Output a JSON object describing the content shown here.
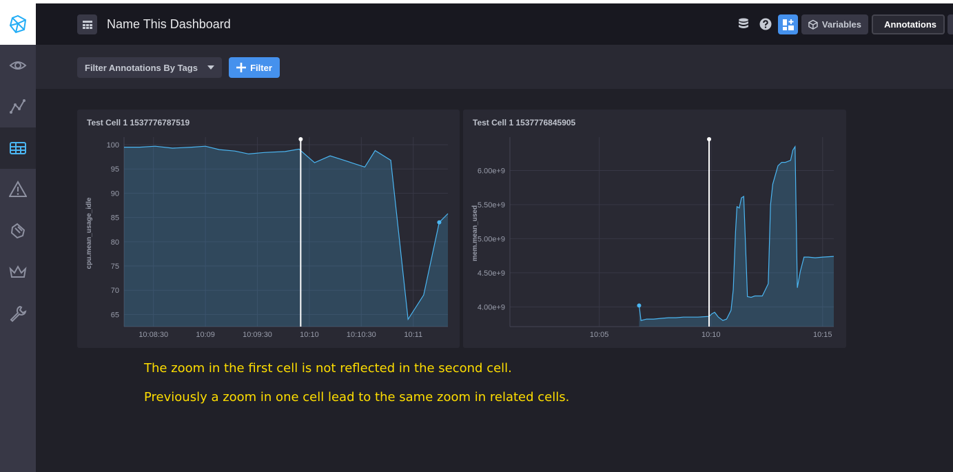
{
  "header": {
    "title": "Name This Dashboard",
    "buttons": {
      "variables": "Variables",
      "annotations": "Annotations"
    }
  },
  "sidebar": {
    "items": [
      {
        "icon": "eye-icon"
      },
      {
        "icon": "graph-icon"
      },
      {
        "icon": "dashboards-icon",
        "active": true
      },
      {
        "icon": "alert-icon"
      },
      {
        "icon": "log-icon"
      },
      {
        "icon": "crown-icon"
      },
      {
        "icon": "wrench-icon"
      }
    ]
  },
  "toolbar": {
    "tag_filter_label": "Filter Annotations By Tags",
    "filter_button_label": "Filter"
  },
  "cells": [
    {
      "title": "Test Cell 1 1537776787519",
      "chart_data": {
        "type": "area",
        "ylabel": "cpu.mean_usage_idle",
        "yticks": [
          100,
          95,
          90,
          85,
          80,
          75,
          70,
          65
        ],
        "ylim": [
          62.5,
          101
        ],
        "xticks": [
          "10:08:30",
          "10:09",
          "10:09:30",
          "10:10",
          "10:10:30",
          "10:11"
        ],
        "xlim": [
          "10:08:13",
          "10:11:20"
        ],
        "annotation": "10:09:55",
        "series": [
          {
            "x": [
              "10:08:13",
              "10:08:22",
              "10:08:31",
              "10:08:41",
              "10:08:52",
              "10:09:00",
              "10:09:08",
              "10:09:17",
              "10:09:25",
              "10:09:34",
              "10:09:46",
              "10:09:54",
              "10:10:03",
              "10:10:12",
              "10:10:20",
              "10:10:32",
              "10:10:38",
              "10:10:47",
              "10:10:57",
              "10:11:06",
              "10:11:15",
              "10:11:20"
            ],
            "y": [
              99.5,
              99.5,
              99.7,
              99.3,
              99.5,
              99.7,
              99.0,
              98.7,
              98.1,
              98.4,
              98.6,
              99.1,
              96.3,
              97.7,
              96.8,
              95.4,
              98.8,
              96.8,
              64,
              69,
              84,
              85.8
            ]
          }
        ],
        "grid": true
      }
    },
    {
      "title": "Test Cell 1 1537776845905",
      "chart_data": {
        "type": "area",
        "ylabel": "mem.mean_used",
        "yticks": [
          "6.00e+9",
          "5.50e+9",
          "5.00e+9",
          "4.50e+9",
          "4.00e+9"
        ],
        "ylim": [
          3710000000.0,
          6450000000.0
        ],
        "xticks": [
          "10:05",
          "10:10",
          "10:15"
        ],
        "xlim": [
          "10:01:00",
          "10:15:30"
        ],
        "annotation": "10:09:55",
        "series": [
          {
            "x": [
              "10:06:47",
              "10:06:52",
              "10:07:07",
              "10:07:26",
              "10:07:44",
              "10:08:06",
              "10:08:26",
              "10:08:46",
              "10:09:05",
              "10:09:25",
              "10:09:55",
              "10:10:03",
              "10:10:10",
              "10:10:20",
              "10:10:32",
              "10:10:42",
              "10:10:54",
              "10:11:00",
              "10:11:06",
              "10:11:10",
              "10:11:16",
              "10:11:22",
              "10:11:28",
              "10:11:38",
              "10:11:48",
              "10:11:58",
              "10:12:18",
              "10:12:34",
              "10:12:40",
              "10:12:46",
              "10:13:00",
              "10:13:10",
              "10:13:20",
              "10:13:34",
              "10:13:40",
              "10:13:46",
              "10:13:52",
              "10:14:00",
              "10:14:10",
              "10:14:22",
              "10:14:40",
              "10:15:00",
              "10:15:30"
            ],
            "y": [
              4020000000.0,
              3800000000.0,
              3820000000.0,
              3820000000.0,
              3830000000.0,
              3840000000.0,
              3840000000.0,
              3850000000.0,
              3850000000.0,
              3850000000.0,
              3860000000.0,
              3900000000.0,
              3920000000.0,
              3850000000.0,
              3800000000.0,
              3820000000.0,
              3950000000.0,
              4250000000.0,
              5100000000.0,
              5470000000.0,
              5450000000.0,
              5600000000.0,
              5620000000.0,
              4150000000.0,
              4140000000.0,
              4160000000.0,
              4160000000.0,
              4340000000.0,
              5500000000.0,
              5800000000.0,
              6070000000.0,
              6120000000.0,
              6120000000.0,
              6150000000.0,
              6300000000.0,
              6350000000.0,
              4280000000.0,
              4520000000.0,
              4730000000.0,
              4730000000.0,
              4720000000.0,
              4730000000.0,
              4740000000.0
            ]
          }
        ],
        "grid": true
      }
    }
  ],
  "notes": [
    "The zoom in the first cell is not reflected in the second cell.",
    "Previously a zoom in one cell lead to the same zoom in related cells."
  ],
  "colors": {
    "accent": "#4591ed",
    "line": "#4bb6f2",
    "note": "#ffde00",
    "annotation": "#ffffff"
  }
}
